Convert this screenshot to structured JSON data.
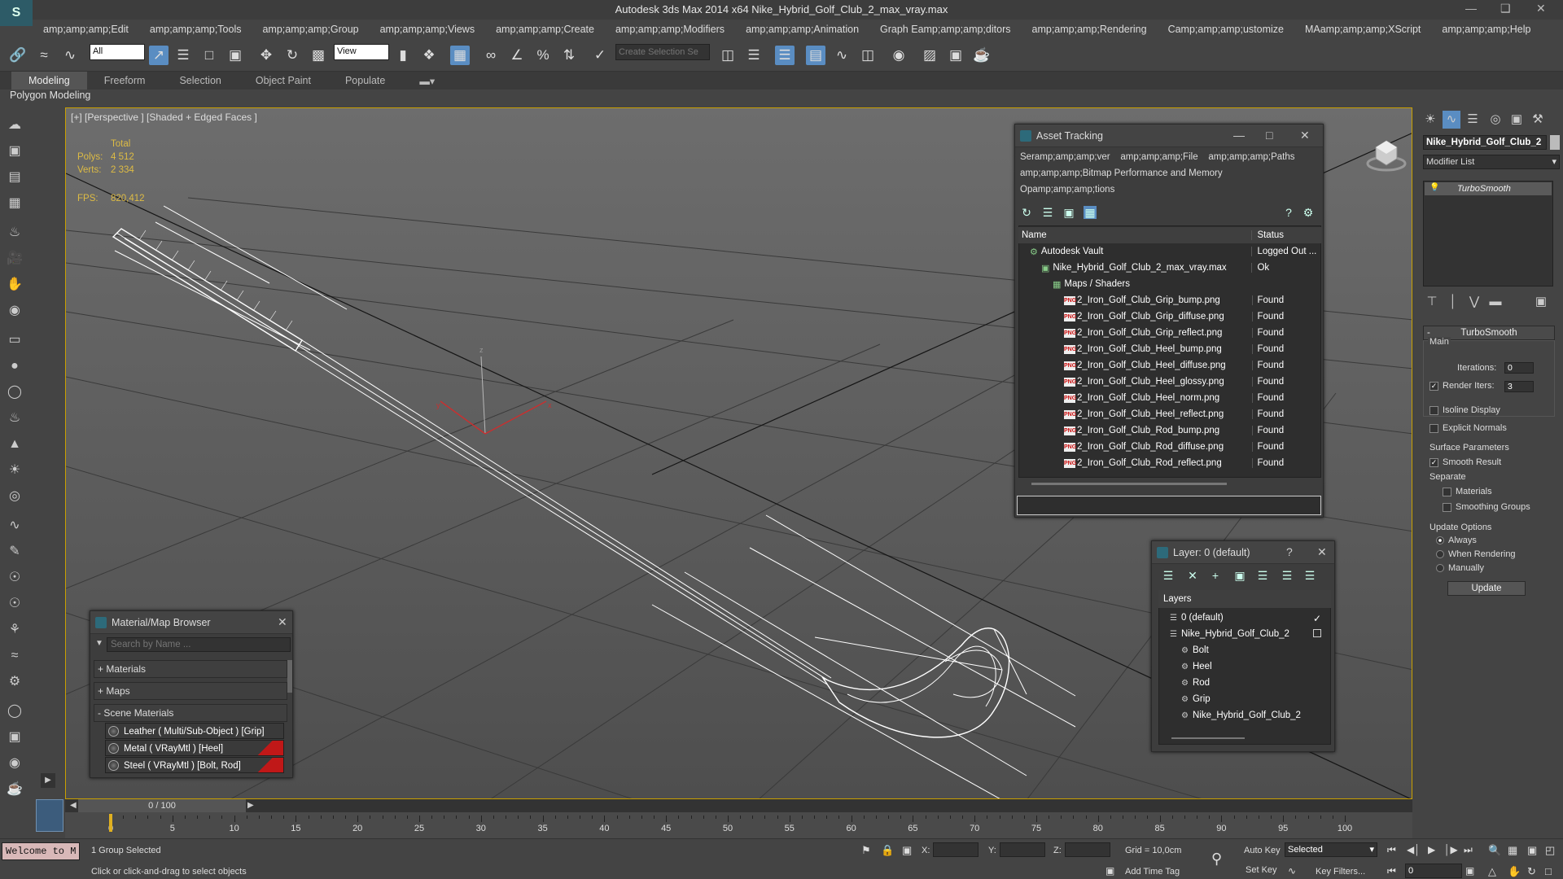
{
  "app": {
    "title": "Autodesk 3ds Max  2014 x64    Nike_Hybrid_Golf_Club_2_max_vray.max",
    "logo": "S"
  },
  "menu": [
    "amp;amp;amp;Edit",
    "amp;amp;amp;Tools",
    "amp;amp;amp;Group",
    "amp;amp;amp;Views",
    "amp;amp;amp;Create",
    "amp;amp;amp;Modifiers",
    "amp;amp;amp;Animation",
    "Graph Eamp;amp;amp;ditors",
    "amp;amp;amp;Rendering",
    "Camp;amp;amp;ustomize",
    "MAamp;amp;amp;XScript",
    "amp;amp;amp;Help"
  ],
  "toolbar": {
    "filter_value": "All",
    "refcoord_value": "View",
    "selection_set_placeholder": "Create Selection Se"
  },
  "ribbon": {
    "tabs": [
      "Modeling",
      "Freeform",
      "Selection",
      "Object Paint",
      "Populate"
    ],
    "active": "Modeling",
    "sub": "Polygon Modeling"
  },
  "viewport": {
    "label": "[+] [Perspective ] [Shaded + Edged Faces ]",
    "stats": {
      "total_label": "Total",
      "polys_label": "Polys:",
      "polys_value": "4 512",
      "verts_label": "Verts:",
      "verts_value": "2 334",
      "fps_label": "FPS:",
      "fps_value": "820,412"
    },
    "axis": {
      "x": "x",
      "y": "y",
      "z": "z"
    }
  },
  "asset_tracking": {
    "title": "Asset Tracking",
    "menu": [
      "Seramp;amp;amp;ver",
      "amp;amp;amp;File",
      "amp;amp;amp;Paths",
      "amp;amp;amp;Bitmap Performance and Memory",
      "Opamp;amp;amp;tions"
    ],
    "columns": [
      "Name",
      "Status"
    ],
    "rows": [
      {
        "name": "Autodesk Vault",
        "status": "Logged Out ...",
        "indent": 0,
        "icon": "vault"
      },
      {
        "name": "Nike_Hybrid_Golf_Club_2_max_vray.max",
        "status": "Ok",
        "indent": 1,
        "icon": "max"
      },
      {
        "name": "Maps / Shaders",
        "status": "",
        "indent": 2,
        "icon": "maps"
      },
      {
        "name": "2_Iron_Golf_Club_Grip_bump.png",
        "status": "Found",
        "indent": 3,
        "icon": "png"
      },
      {
        "name": "2_Iron_Golf_Club_Grip_diffuse.png",
        "status": "Found",
        "indent": 3,
        "icon": "png"
      },
      {
        "name": "2_Iron_Golf_Club_Grip_reflect.png",
        "status": "Found",
        "indent": 3,
        "icon": "png"
      },
      {
        "name": "2_Iron_Golf_Club_Heel_bump.png",
        "status": "Found",
        "indent": 3,
        "icon": "png"
      },
      {
        "name": "2_Iron_Golf_Club_Heel_diffuse.png",
        "status": "Found",
        "indent": 3,
        "icon": "png"
      },
      {
        "name": "2_Iron_Golf_Club_Heel_glossy.png",
        "status": "Found",
        "indent": 3,
        "icon": "png"
      },
      {
        "name": "2_Iron_Golf_Club_Heel_norm.png",
        "status": "Found",
        "indent": 3,
        "icon": "png"
      },
      {
        "name": "2_Iron_Golf_Club_Heel_reflect.png",
        "status": "Found",
        "indent": 3,
        "icon": "png"
      },
      {
        "name": "2_Iron_Golf_Club_Rod_bump.png",
        "status": "Found",
        "indent": 3,
        "icon": "png"
      },
      {
        "name": "2_Iron_Golf_Club_Rod_diffuse.png",
        "status": "Found",
        "indent": 3,
        "icon": "png"
      },
      {
        "name": "2_Iron_Golf_Club_Rod_reflect.png",
        "status": "Found",
        "indent": 3,
        "icon": "png"
      }
    ],
    "png_badge": "PNG"
  },
  "layer_panel": {
    "title": "Layer: 0 (default)",
    "help": "?",
    "column": "Layers",
    "rows": [
      {
        "name": "0 (default)",
        "indent": 0
      },
      {
        "name": "Nike_Hybrid_Golf_Club_2",
        "indent": 0
      },
      {
        "name": "Bolt",
        "indent": 1
      },
      {
        "name": "Heel",
        "indent": 1
      },
      {
        "name": "Rod",
        "indent": 1
      },
      {
        "name": "Grip",
        "indent": 1
      },
      {
        "name": "Nike_Hybrid_Golf_Club_2",
        "indent": 1
      }
    ]
  },
  "material_browser": {
    "title": "Material/Map Browser",
    "search_placeholder": "Search by Name ...",
    "groups": [
      "+ Materials",
      "+ Maps",
      "- Scene Materials"
    ],
    "items": [
      "Leather  ( Multi/Sub-Object ) [Grip]",
      "Metal  ( VRayMtl ) [Heel]",
      "Steel  ( VRayMtl ) [Bolt, Rod]"
    ]
  },
  "command_panel": {
    "object_name": "Nike_Hybrid_Golf_Club_2",
    "modifier_list": "Modifier List",
    "stack_item": "TurboSmooth",
    "rollout_title": "TurboSmooth",
    "main_label": "Main",
    "iterations_label": "Iterations:",
    "iterations_value": "0",
    "render_iters_label": "Render Iters:",
    "render_iters_value": "3",
    "isoline": "Isoline Display",
    "explicit": "Explicit Normals",
    "surface_label": "Surface Parameters",
    "smooth_result": "Smooth Result",
    "separate_label": "Separate",
    "materials": "Materials",
    "smoothing_groups": "Smoothing Groups",
    "update_options": "Update Options",
    "always": "Always",
    "when_rendering": "When Rendering",
    "manually": "Manually",
    "update_btn": "Update"
  },
  "timeline": {
    "frame": "0 / 100",
    "ticks": [
      "0",
      "5",
      "10",
      "15",
      "20",
      "25",
      "30",
      "35",
      "40",
      "45",
      "50",
      "55",
      "60",
      "65",
      "70",
      "75",
      "80",
      "85",
      "90",
      "95",
      "100"
    ]
  },
  "status": {
    "welcome": "Welcome to M",
    "selected": "1 Group Selected",
    "hint": "Click or click-and-drag to select objects",
    "x_label": "X:",
    "y_label": "Y:",
    "z_label": "Z:",
    "grid": "Grid = 10,0cm",
    "add_time_tag": "Add Time Tag",
    "auto_key": "Auto Key",
    "set_key": "Set Key",
    "selected_dropdown": "Selected",
    "key_filters": "Key Filters...",
    "frame_value": "0"
  }
}
